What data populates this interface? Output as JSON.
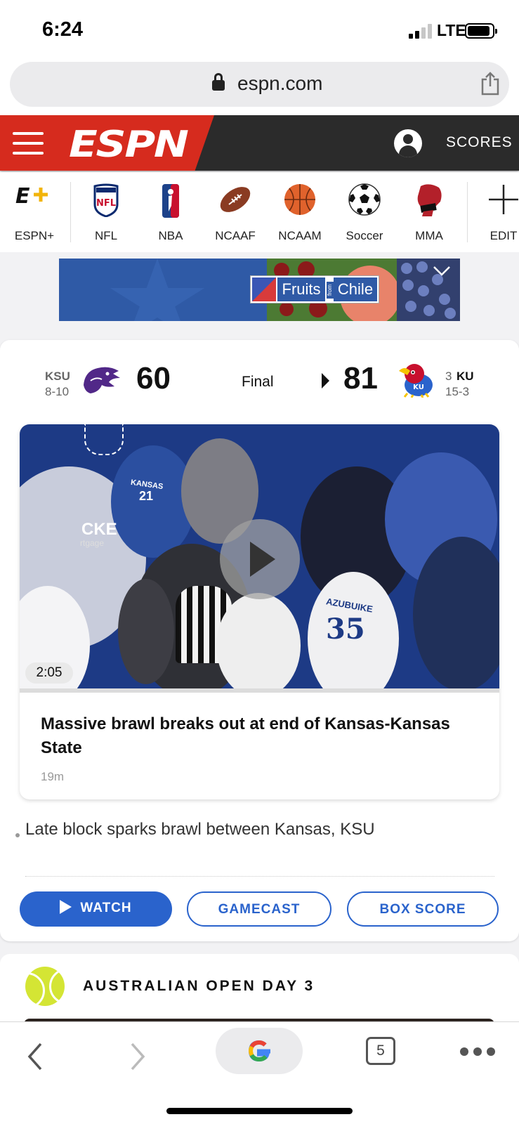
{
  "status_bar": {
    "time": "6:24",
    "network": "LTE"
  },
  "browser": {
    "url": "espn.com",
    "tab_count": "5"
  },
  "header": {
    "logo": "ESPN",
    "scores_label": "SCORES"
  },
  "sport_nav": {
    "items": [
      {
        "label": "ESPN+",
        "icon": "espn-plus-icon"
      },
      {
        "label": "NFL",
        "icon": "nfl-icon"
      },
      {
        "label": "NBA",
        "icon": "nba-icon"
      },
      {
        "label": "NCAAF",
        "icon": "football-icon"
      },
      {
        "label": "NCAAM",
        "icon": "basketball-icon"
      },
      {
        "label": "Soccer",
        "icon": "soccer-ball-icon"
      },
      {
        "label": "MMA",
        "icon": "mma-glove-icon"
      }
    ],
    "edit_label": "EDIT"
  },
  "ad": {
    "brand_left": "Fruits",
    "brand_from": "from",
    "brand_right": "Chile"
  },
  "game": {
    "away": {
      "abbr": "KSU",
      "record": "8-10",
      "score": "60"
    },
    "home": {
      "rank": "3",
      "abbr": "KU",
      "record": "15-3",
      "score": "81"
    },
    "status": "Final"
  },
  "video": {
    "duration": "2:05",
    "title": "Massive brawl breaks out at end of Kansas-Kansas State",
    "age": "19m",
    "scene_text": {
      "jersey_35_name": "AZUBUIKE",
      "jersey_35_number": "35",
      "jersey_21_text": "KANSAS",
      "jersey_21_number": "21",
      "banner_text": "CKE",
      "banner_sub": "rtgage"
    }
  },
  "related": {
    "headline": "Late block sparks brawl between Kansas, KSU"
  },
  "actions": {
    "watch": "WATCH",
    "gamecast": "GAMECAST",
    "box_score": "BOX SCORE"
  },
  "next_section": {
    "title": "AUSTRALIAN OPEN DAY 3"
  },
  "colors": {
    "espn_red": "#d62b1e",
    "header_dark": "#2b2b2b",
    "action_blue": "#2a63cc"
  }
}
